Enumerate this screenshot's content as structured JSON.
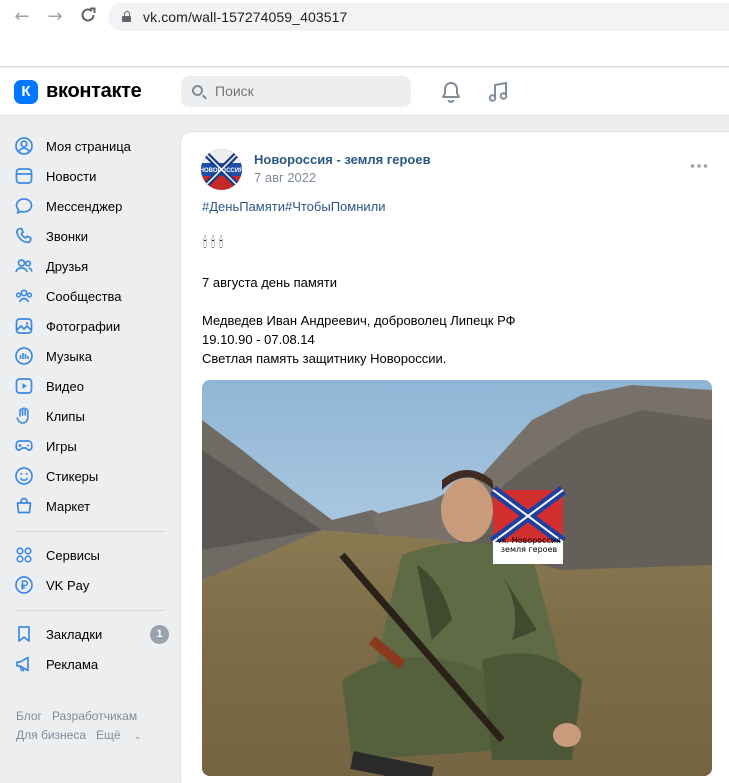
{
  "browser": {
    "url": "vk.com/wall-157274059_403517",
    "back_icon": "arrow-left-icon",
    "forward_icon": "arrow-right-icon",
    "reload_icon": "reload-icon"
  },
  "header": {
    "logo_letter": "К",
    "wordmark": "вконтакте",
    "search_placeholder": "Поиск",
    "accent": "#0077ff"
  },
  "sidebar": {
    "items": [
      {
        "label": "Моя страница",
        "icon": "user-circle-icon"
      },
      {
        "label": "Новости",
        "icon": "news-icon"
      },
      {
        "label": "Мессенджер",
        "icon": "message-icon"
      },
      {
        "label": "Звонки",
        "icon": "phone-icon"
      },
      {
        "label": "Друзья",
        "icon": "friends-icon"
      },
      {
        "label": "Сообщества",
        "icon": "communities-icon"
      },
      {
        "label": "Фотографии",
        "icon": "photo-icon"
      },
      {
        "label": "Музыка",
        "icon": "music-bars-icon"
      },
      {
        "label": "Видео",
        "icon": "video-icon"
      },
      {
        "label": "Клипы",
        "icon": "clips-icon"
      },
      {
        "label": "Игры",
        "icon": "gamepad-icon"
      },
      {
        "label": "Стикеры",
        "icon": "smile-icon"
      },
      {
        "label": "Маркет",
        "icon": "bag-icon"
      }
    ],
    "items2": [
      {
        "label": "Сервисы",
        "icon": "services-icon"
      },
      {
        "label": "VK Pay",
        "icon": "vkpay-icon"
      }
    ],
    "items3": [
      {
        "label": "Закладки",
        "icon": "bookmark-icon",
        "badge": "1"
      },
      {
        "label": "Реклама",
        "icon": "megaphone-icon"
      }
    ],
    "footer": {
      "blog": "Блог",
      "developers": "Разработчикам",
      "business": "Для бизнеса",
      "more": "Ещё"
    }
  },
  "post": {
    "group_name": "Новороссия - земля героев",
    "date": "7 авг 2022",
    "hashtags": "#ДеньПамяти#ЧтобыПомнили",
    "candles": "🕯🕯🕯",
    "line1": "7 августа день памяти",
    "line2": "Медведев Иван Андреевич, доброволец Липецк РФ",
    "line3": "19.10.90 - 07.08.14",
    "line4": "Светлая память защитнику Новороссии.",
    "watermark_line1": "vk. Новороссия",
    "watermark_line2": "земля героев"
  }
}
